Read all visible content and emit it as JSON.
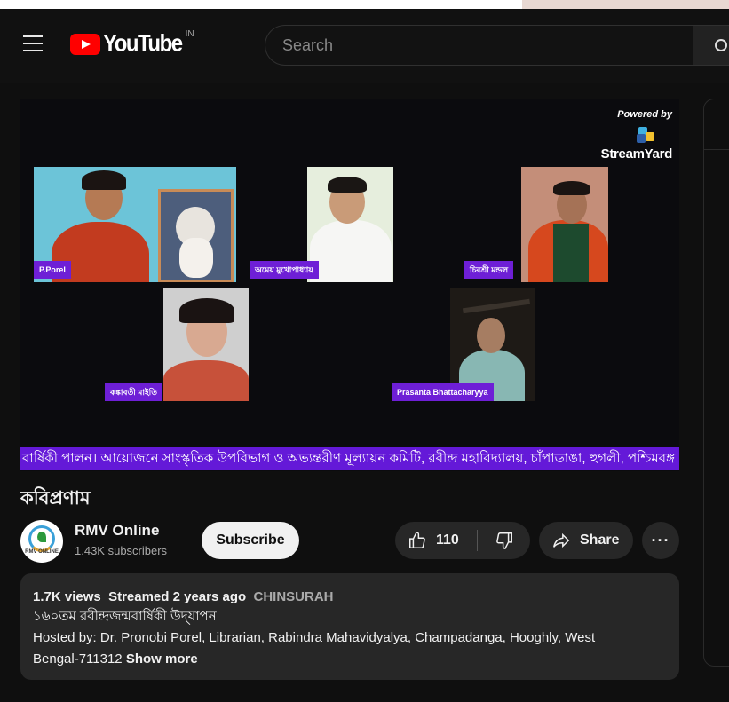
{
  "header": {
    "brand": "YouTube",
    "country_code": "IN",
    "search_placeholder": "Search"
  },
  "player": {
    "powered_by": "Powered by",
    "brand": "StreamYard",
    "participants": [
      "P.Porel",
      "অমেয় মুখোপাধ্যায়",
      "চিরশ্রী মন্ডল",
      "কঙ্কাবতী মাইতি",
      "Prasanta Bhattacharyya"
    ],
    "ticker": "বার্ষিকী পালন। আয়োজনে সাংস্কৃতিক উপবিভাগ ও অভ্যন্তরীণ মূল্যায়ন কমিটি, রবীন্দ্র মহাবিদ্যালয়, চাঁপাডাঙা, হুগলী, পশ্চিমবঙ্গ"
  },
  "video": {
    "title": "কবিপ্রণাম"
  },
  "channel": {
    "avatar_text": "RMV ONLINE",
    "name": "RMV Online",
    "subscribers": "1.43K subscribers",
    "subscribe_label": "Subscribe"
  },
  "actions": {
    "like_count": "110",
    "share_label": "Share",
    "more_label": "···"
  },
  "description": {
    "views": "1.7K views",
    "streamed": "Streamed 2 years ago",
    "location_tag": "CHINSURAH",
    "line1": "১৬০তম রবীন্দ্রজন্মবার্ষিকী উদ্‌যাপন",
    "line2": "Hosted by: Dr. Pronobi Porel, Librarian, Rabindra Mahavidyalya, Champadanga, Hooghly, West",
    "line3": "Bengal-711312",
    "show_more": "Show more"
  },
  "colors": {
    "brand_red": "#ff0000",
    "label_purple": "#6e1fd6",
    "ticker_purple": "#6419d8",
    "background": "#0f0f0f",
    "button_bg": "#272727"
  }
}
